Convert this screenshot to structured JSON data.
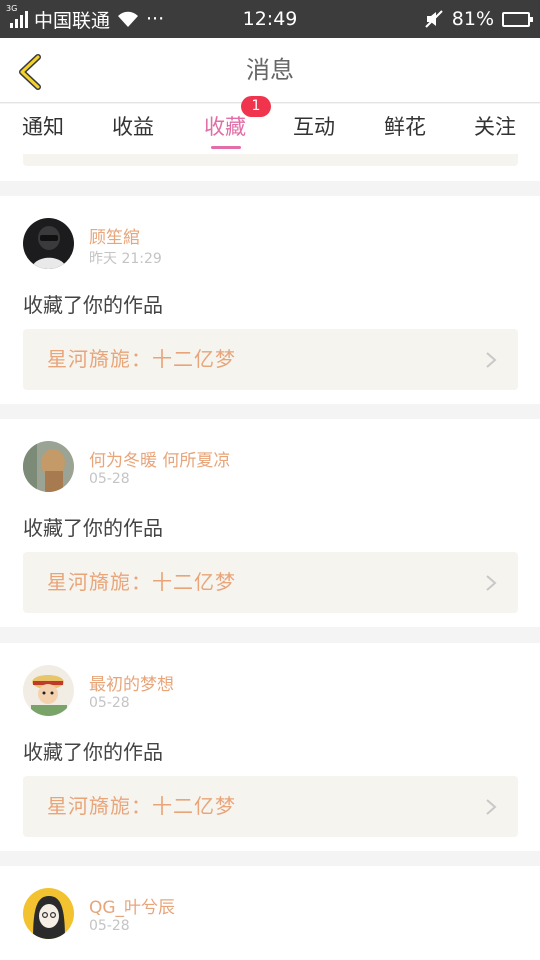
{
  "status_bar": {
    "network": "3G",
    "carrier": "中国联通",
    "dots": "···",
    "time": "12:49",
    "battery": "81%",
    "battery_level": 0.81
  },
  "header": {
    "title": "消息"
  },
  "tabs": [
    {
      "label": "通知"
    },
    {
      "label": "收益"
    },
    {
      "label": "收藏",
      "active": true,
      "badge": "1"
    },
    {
      "label": "互动"
    },
    {
      "label": "鲜花"
    },
    {
      "label": "关注"
    }
  ],
  "colors": {
    "accent": "#e26ea8",
    "name": "#e8a57a",
    "badge": "#f0344d",
    "card_inner": "#f5f4ef"
  },
  "items": [
    {
      "user": "顾笙綰",
      "time": "昨天 21:29",
      "action": "收藏了你的作品",
      "work": "星河旖旎：十二亿梦"
    },
    {
      "user": "何为冬暖 何所夏凉",
      "time": "05-28",
      "action": "收藏了你的作品",
      "work": "星河旖旎：十二亿梦"
    },
    {
      "user": "最初的梦想",
      "time": "05-28",
      "action": "收藏了你的作品",
      "work": "星河旖旎：十二亿梦"
    },
    {
      "user": "QG_叶兮辰",
      "time": "05-28"
    }
  ]
}
